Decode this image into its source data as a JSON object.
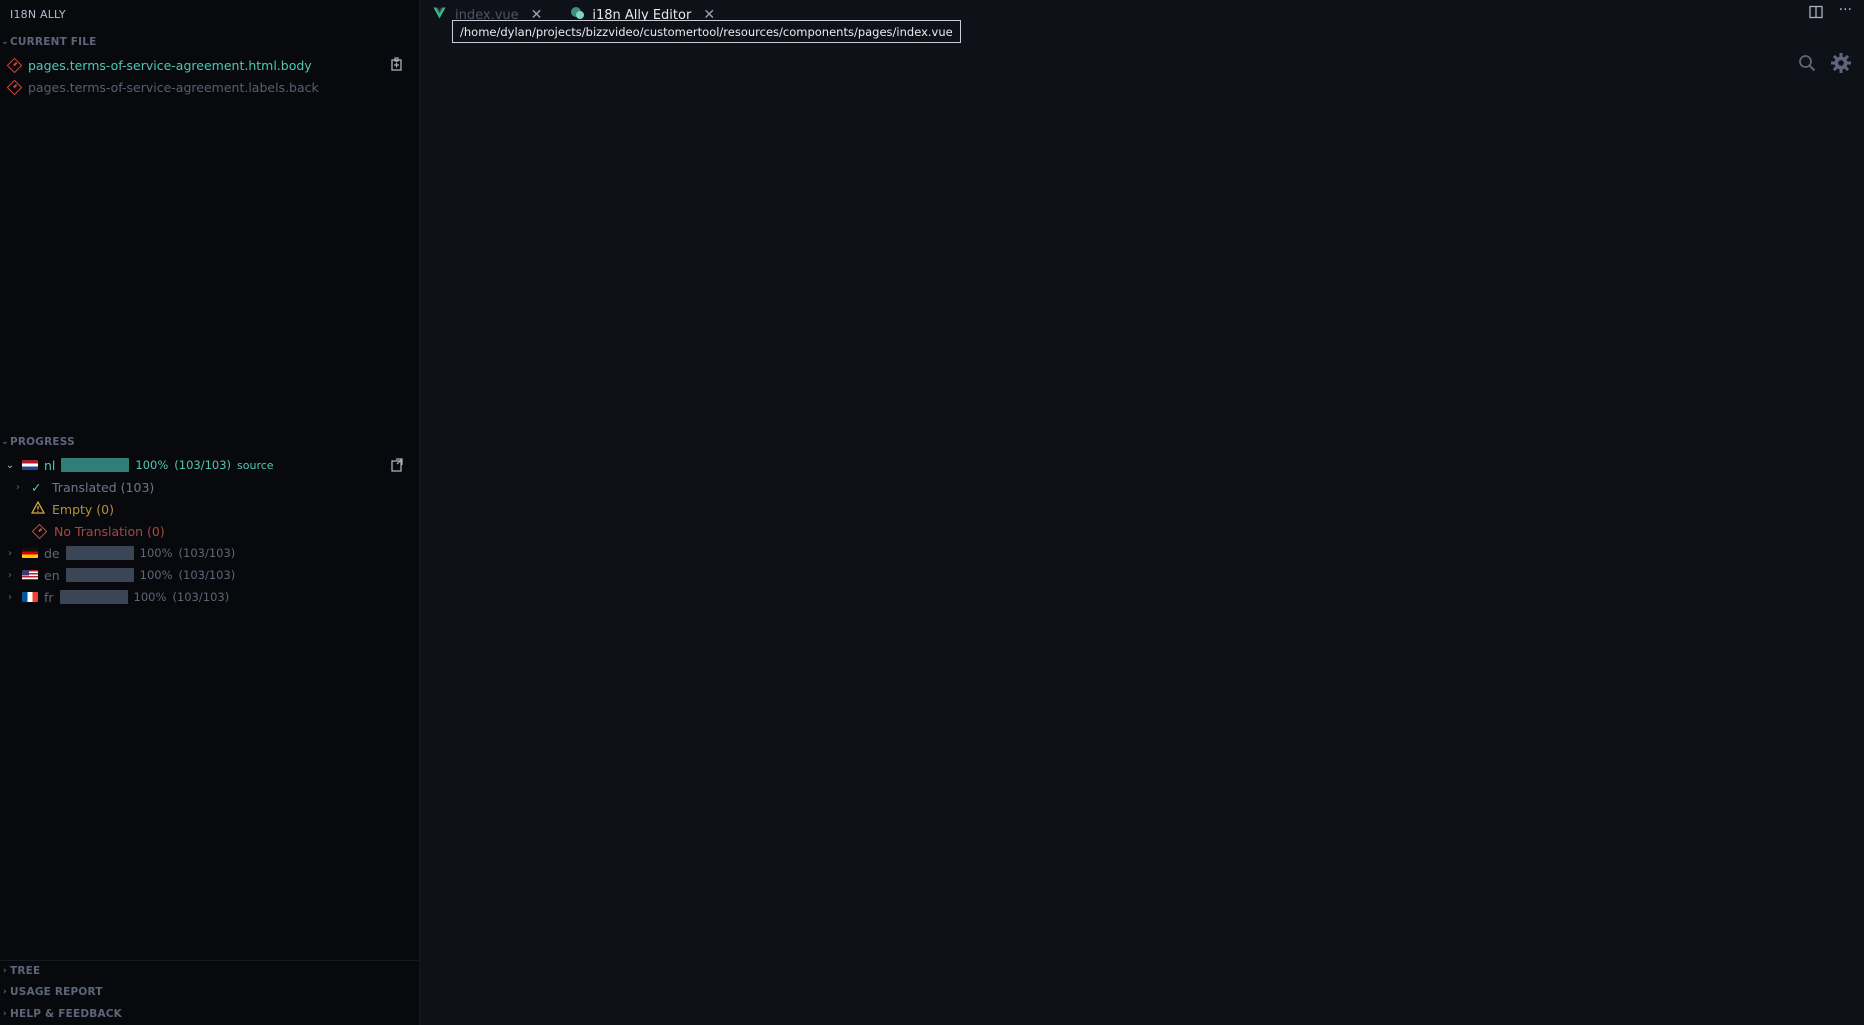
{
  "sidebar": {
    "title": "I18N ALLY",
    "current_file": {
      "header": "CURRENT FILE",
      "items": [
        {
          "label": "pages.terms-of-service-agreement.html.body",
          "color": "#4ec9b0"
        },
        {
          "label": "pages.terms-of-service-agreement.labels.back",
          "color": "#556070"
        }
      ]
    },
    "progress": {
      "header": "PROGRESS",
      "locales": [
        {
          "code": "nl",
          "percent": "100%",
          "count": "(103/103)",
          "tag": "source",
          "fill": 1.0,
          "expanded": true,
          "flag": "nl-flag"
        },
        {
          "code": "de",
          "percent": "100%",
          "count": "(103/103)",
          "fill": 1.0,
          "expanded": false,
          "flag": "de-flag"
        },
        {
          "code": "en",
          "percent": "100%",
          "count": "(103/103)",
          "fill": 1.0,
          "expanded": false,
          "flag": "us-flag"
        },
        {
          "code": "fr",
          "percent": "100%",
          "count": "(103/103)",
          "fill": 1.0,
          "expanded": false,
          "flag": "fr-flag"
        }
      ],
      "nl_children": [
        {
          "label": "Translated (103)",
          "icon": "check-icon"
        },
        {
          "label": "Empty (0)",
          "icon": "warning-icon"
        },
        {
          "label": "No Translation (0)",
          "icon": "missing-diamond-icon"
        }
      ]
    },
    "bottom_sections": [
      "TREE",
      "USAGE REPORT",
      "HELP & FEEDBACK"
    ]
  },
  "tabs": [
    {
      "label": "index.vue",
      "icon": "vue-icon",
      "active": false
    },
    {
      "label": "i18n Ally Editor",
      "icon": "i18n-ally-icon",
      "active": true
    }
  ],
  "tooltip": "/home/dylan/projects/bizzvideo/customertool/resources/components/pages/index.vue",
  "colors": {
    "accent": "#4ec9b0",
    "error": "#c94a3b",
    "warning": "#d7a740",
    "bar_source": "#2f7f78",
    "bar_other": "#3a4556"
  }
}
